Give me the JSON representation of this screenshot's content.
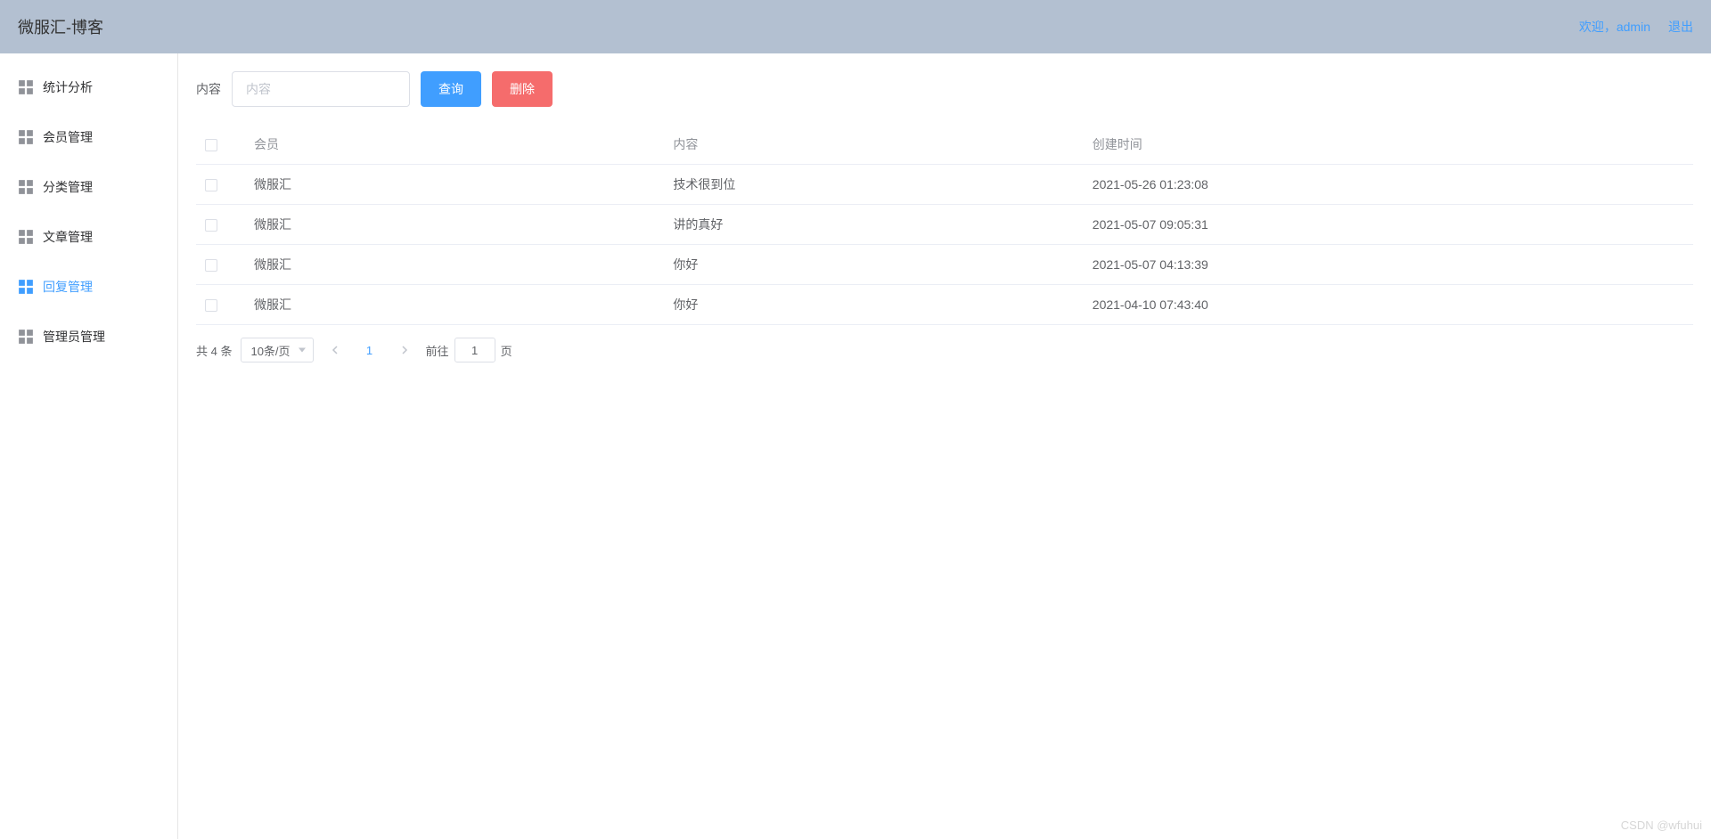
{
  "header": {
    "title": "微服汇-博客",
    "welcome_prefix": "欢迎，",
    "username": "admin",
    "logout": "退出"
  },
  "sidebar": {
    "items": [
      {
        "label": "统计分析",
        "active": false
      },
      {
        "label": "会员管理",
        "active": false
      },
      {
        "label": "分类管理",
        "active": false
      },
      {
        "label": "文章管理",
        "active": false
      },
      {
        "label": "回复管理",
        "active": true
      },
      {
        "label": "管理员管理",
        "active": false
      }
    ]
  },
  "toolbar": {
    "content_label": "内容",
    "content_placeholder": "内容",
    "query_label": "查询",
    "delete_label": "删除"
  },
  "table": {
    "headers": {
      "member": "会员",
      "content": "内容",
      "created_at": "创建时间"
    },
    "rows": [
      {
        "member": "微服汇",
        "content": "技术很到位",
        "created_at": "2021-05-26 01:23:08"
      },
      {
        "member": "微服汇",
        "content": "讲的真好",
        "created_at": "2021-05-07 09:05:31"
      },
      {
        "member": "微服汇",
        "content": "你好",
        "created_at": "2021-05-07 04:13:39"
      },
      {
        "member": "微服汇",
        "content": "你好",
        "created_at": "2021-04-10 07:43:40"
      }
    ]
  },
  "pagination": {
    "total_text": "共 4 条",
    "page_size_label": "10条/页",
    "current_page": "1",
    "jump_prefix": "前往",
    "jump_value": "1",
    "jump_suffix": "页"
  },
  "watermark": "CSDN @wfuhui"
}
